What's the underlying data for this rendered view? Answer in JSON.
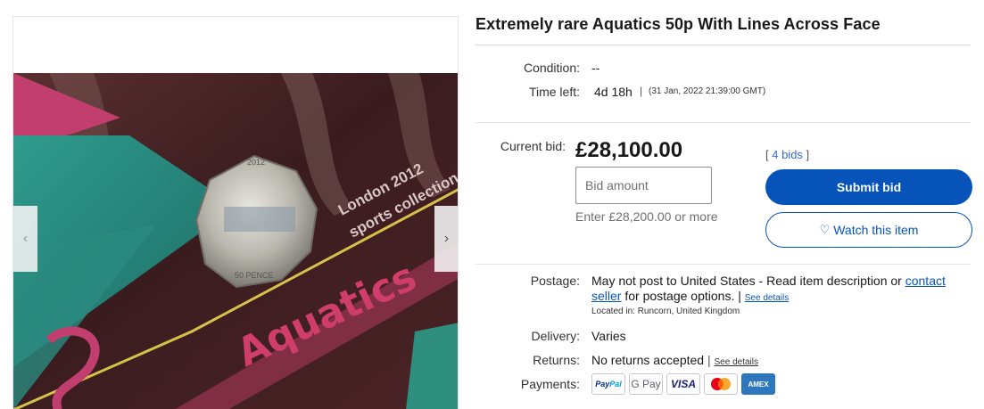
{
  "listing": {
    "title": "Extremely rare Aquatics 50p With Lines Across Face"
  },
  "gallery": {
    "prev_icon": "‹",
    "next_icon": "›",
    "photo_texts": [
      "London 2012",
      "sports collection",
      "50 PENCE",
      "Aquatics"
    ]
  },
  "summary": {
    "condition_label": "Condition:",
    "condition_value": "--",
    "time_left_label": "Time left:",
    "time_left_value": "4d 18h",
    "time_separator": "|",
    "end_date": "(31 Jan, 2022  21:39:00 GMT)"
  },
  "bidding": {
    "current_bid_label": "Current bid:",
    "current_bid_value": "£28,100.00",
    "bids_open": "[ ",
    "bids_count_text": "4 bids",
    "bids_close": " ]",
    "bid_input_placeholder": "Bid amount",
    "min_bid_hint": "Enter £28,200.00 or more",
    "submit_label": "Submit bid",
    "watch_icon": "♡",
    "watch_label": "Watch this item",
    "primary_color": "#0654ba"
  },
  "shipping": {
    "postage_label": "Postage:",
    "postage_text": "May not post to United States - Read item description or ",
    "contact_seller_link": "contact seller",
    "postage_suffix": " for postage options. | ",
    "see_details_1": "See details",
    "located_in": "Located in:  Runcorn, United Kingdom",
    "delivery_label": "Delivery:",
    "delivery_value": "Varies",
    "returns_label": "Returns:",
    "returns_value": "No returns accepted",
    "returns_sep": " | ",
    "see_details_2": "See details",
    "payments_label": "Payments:",
    "payment_methods": {
      "paypal_a": "Pay",
      "paypal_b": "Pal",
      "gpay": "G Pay",
      "visa": "VISA",
      "amex": "AMEX"
    }
  }
}
